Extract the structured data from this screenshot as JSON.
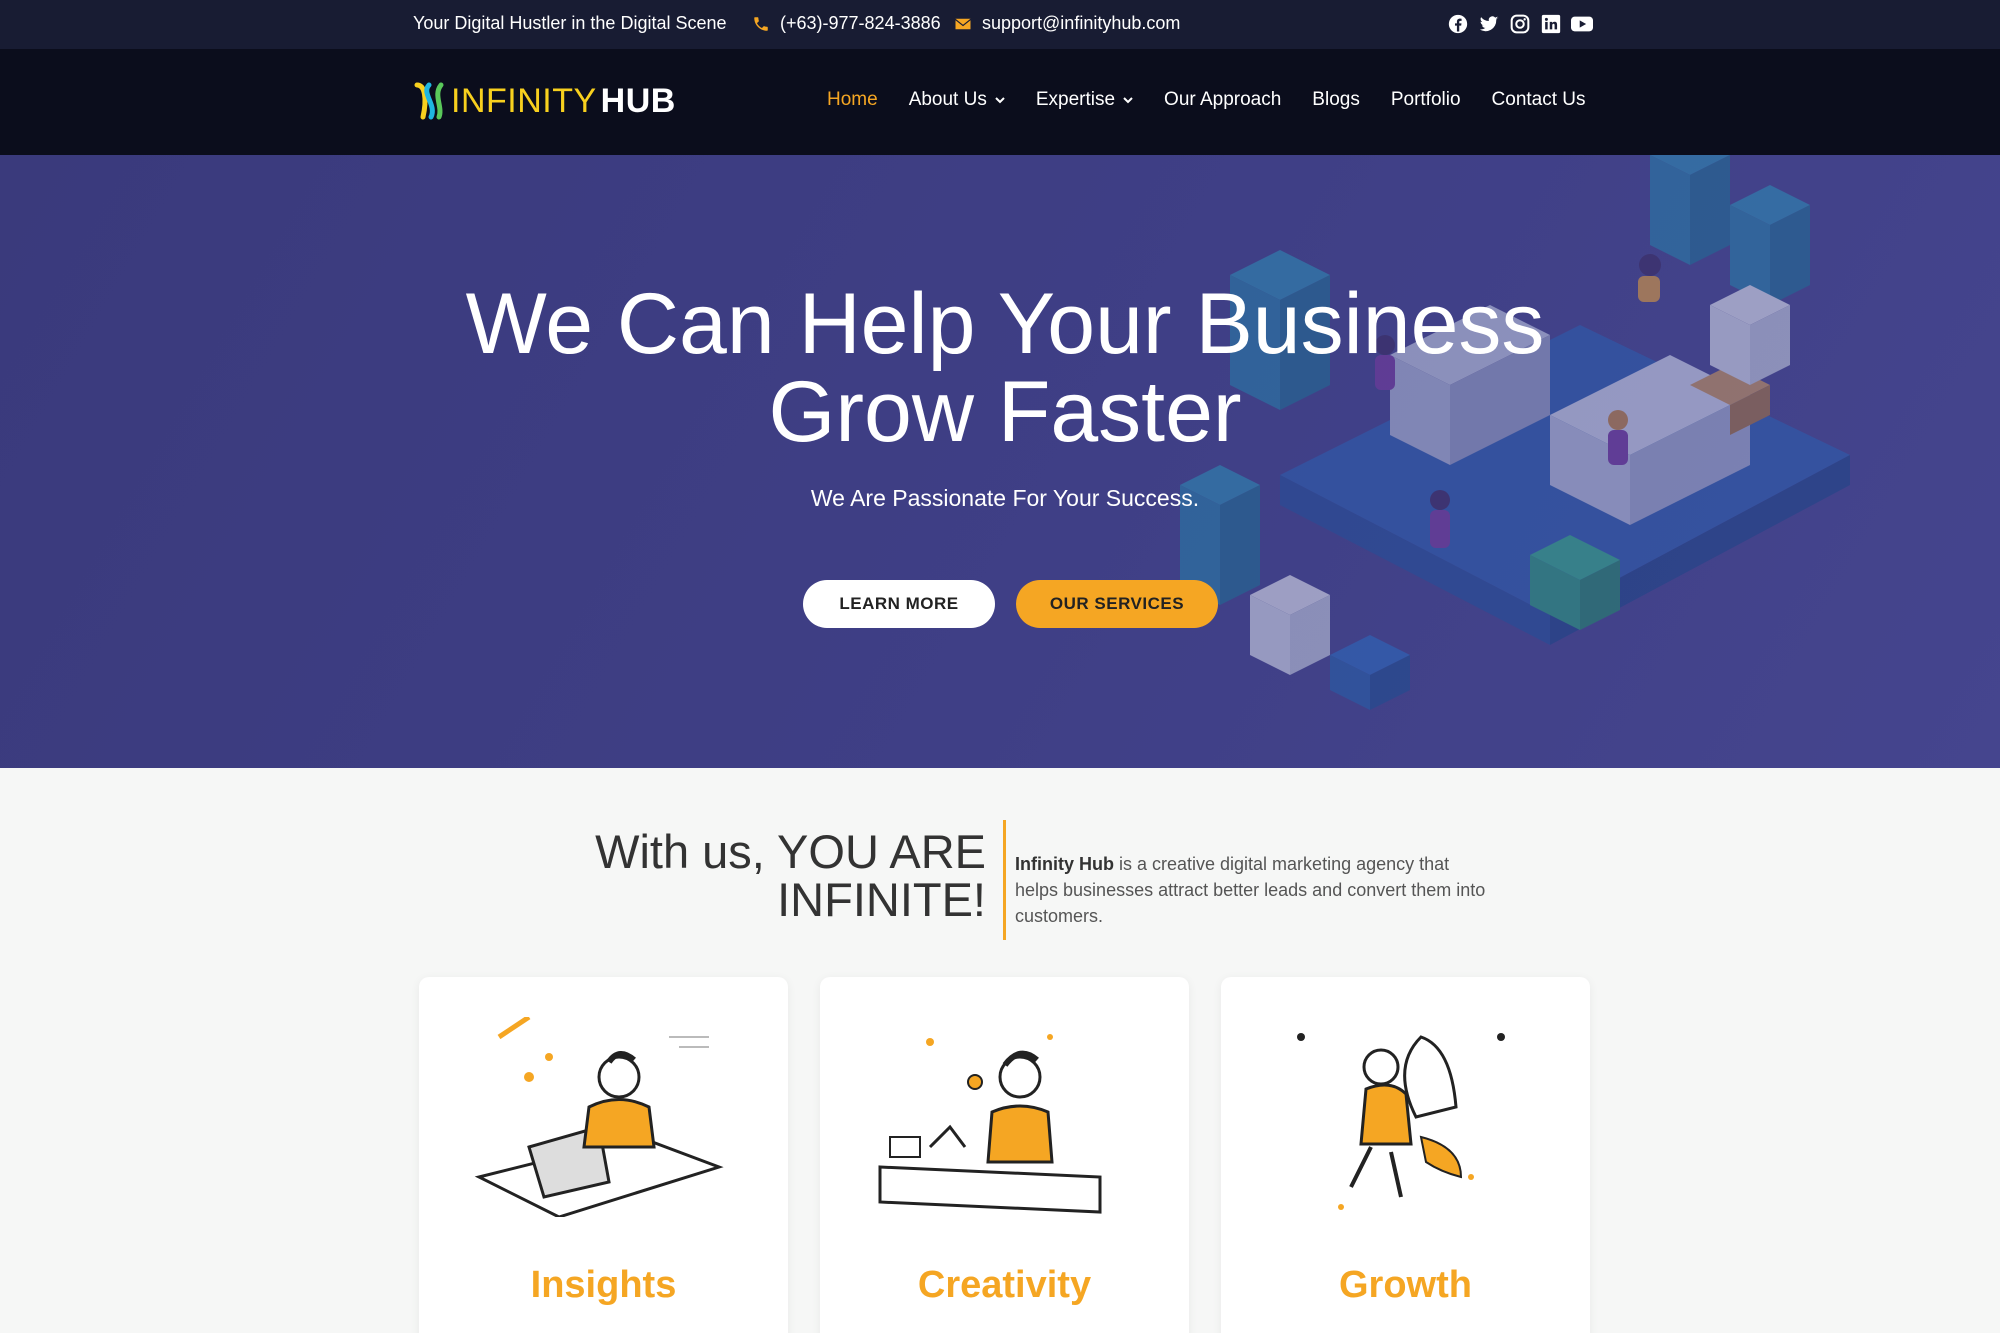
{
  "topbar": {
    "tagline": "Your Digital Hustler in the Digital Scene",
    "phone": "(+63)-977-824-3886",
    "email": "support@infinityhub.com",
    "socials": [
      "facebook-icon",
      "twitter-icon",
      "instagram-icon",
      "linkedin-icon",
      "youtube-icon"
    ]
  },
  "brand": {
    "part1": "INFINITY",
    "part2": "HUB"
  },
  "nav": [
    {
      "label": "Home",
      "active": true
    },
    {
      "label": "About Us",
      "dropdown": true
    },
    {
      "label": "Expertise",
      "dropdown": true
    },
    {
      "label": "Our Approach"
    },
    {
      "label": "Blogs"
    },
    {
      "label": "Portfolio"
    },
    {
      "label": "Contact Us"
    }
  ],
  "hero": {
    "title_line1": "We Can Help Your Business",
    "title_line2": "Grow Faster",
    "subtitle": "We Are Passionate For Your Success.",
    "learn_more": "LEARN MORE",
    "our_services": "OUR SERVICES"
  },
  "intro": {
    "title_line1": "With us, YOU ARE",
    "title_line2": "INFINITE!",
    "company": "Infinity Hub",
    "description": " is a creative digital marketing agency that helps businesses attract better leads and convert them into customers."
  },
  "cards": [
    {
      "label": "Insights"
    },
    {
      "label": "Creativity"
    },
    {
      "label": "Growth"
    }
  ],
  "colors": {
    "accent": "#f5a623",
    "topbar": "#181c33",
    "navbar": "#0b0d1c",
    "hero": "#3f3f86"
  }
}
